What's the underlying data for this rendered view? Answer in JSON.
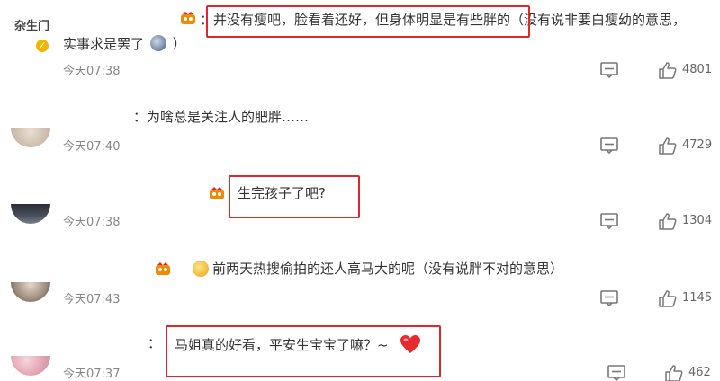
{
  "comments": [
    {
      "username": "杂生门",
      "text_line1": "：并没有瘦吧，脸看着还好，但身体明显是有些胖的（没有说非要白瘦幼的意思，",
      "text_line2": "实事求是罢了",
      "text_line2_end": "）",
      "time": "今天07:38",
      "likes": "4801"
    },
    {
      "text": "：为啥总是关注人的肥胖……",
      "time": "今天07:40",
      "likes": "4729"
    },
    {
      "text": "生完孩子了吧?",
      "time": "今天07:38",
      "likes": "1304"
    },
    {
      "text": "前两天热搜偷拍的还人高马大的呢（没有说胖不对的意思）",
      "time": "今天07:43",
      "likes": "1145"
    },
    {
      "text": "马姐真的好看，平安生宝宝了嘛？~",
      "time": "今天07:37",
      "likes": "462"
    }
  ],
  "icons": {
    "comment": "comment-icon",
    "like": "thumbs-up-icon",
    "crown": "crown-badge-icon",
    "verified": "verified-badge-icon",
    "heart": "heart-emoji",
    "face": "emoji-face-icon"
  },
  "colors": {
    "highlight": "#e0282a",
    "verified": "#f5b400",
    "badge": "#f08a00"
  }
}
